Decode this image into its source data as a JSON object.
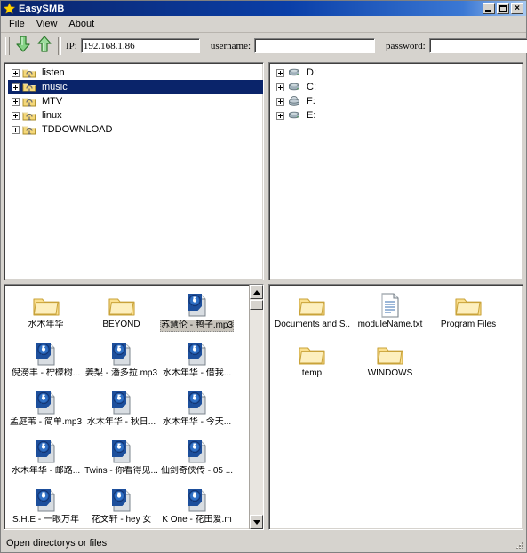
{
  "window": {
    "title": "EasySMB",
    "icon": "star-icon",
    "buttons": {
      "minimize": "minimize-button",
      "maximize": "maximize-button",
      "close": "×"
    }
  },
  "menu": {
    "items": [
      {
        "label": "File",
        "mnemonic": "F"
      },
      {
        "label": "View",
        "mnemonic": "V"
      },
      {
        "label": "About",
        "mnemonic": "A"
      }
    ]
  },
  "toolbar": {
    "download_icon": "green-down-arrow-icon",
    "upload_icon": "green-up-arrow-icon",
    "ip": {
      "label": "IP:",
      "value": "192.168.1.86",
      "placeholder": ""
    },
    "username": {
      "label": "username:",
      "value": "",
      "placeholder": ""
    },
    "password": {
      "label": "password:",
      "value": "",
      "placeholder": ""
    }
  },
  "remote_tree": {
    "nodes": [
      {
        "label": "listen",
        "icon": "share-folder-icon",
        "selected": false
      },
      {
        "label": "music",
        "icon": "share-folder-icon",
        "selected": true
      },
      {
        "label": "MTV",
        "icon": "share-folder-icon",
        "selected": false
      },
      {
        "label": "linux",
        "icon": "share-folder-icon",
        "selected": false
      },
      {
        "label": "TDDOWNLOAD",
        "icon": "share-folder-icon",
        "selected": false
      }
    ]
  },
  "local_tree": {
    "nodes": [
      {
        "label": "D:",
        "icon": "hard-drive-icon",
        "selected": false
      },
      {
        "label": "C:",
        "icon": "hard-drive-icon",
        "selected": false
      },
      {
        "label": "F:",
        "icon": "cdrom-drive-icon",
        "selected": false
      },
      {
        "label": "E:",
        "icon": "hard-drive-icon",
        "selected": false
      }
    ]
  },
  "remote_files": {
    "items": [
      {
        "name": "水木年华",
        "icon": "folder-icon",
        "selected": false
      },
      {
        "name": "BEYOND",
        "icon": "folder-icon",
        "selected": false
      },
      {
        "name": "苏慧伦 - 鸭子.mp3",
        "icon": "media-file-icon",
        "selected": true
      },
      {
        "name": "倪澇丰 - 柠檬树...",
        "icon": "media-file-icon",
        "selected": false
      },
      {
        "name": "姜梨 - 潘多拉.mp3",
        "icon": "media-file-icon",
        "selected": false
      },
      {
        "name": "水木年华 - 借我...",
        "icon": "media-file-icon",
        "selected": false
      },
      {
        "name": "孟庭苇 - 简单.mp3",
        "icon": "media-file-icon",
        "selected": false
      },
      {
        "name": "水木年华 - 秋日...",
        "icon": "media-file-icon",
        "selected": false
      },
      {
        "name": "水木年华 - 今天...",
        "icon": "media-file-icon",
        "selected": false
      },
      {
        "name": "水木年华 - 邮路...",
        "icon": "media-file-icon",
        "selected": false
      },
      {
        "name": "Twins - 你看得见...",
        "icon": "media-file-icon",
        "selected": false
      },
      {
        "name": "仙剑奇侠传 - 05 ...",
        "icon": "media-file-icon",
        "selected": false
      },
      {
        "name": "S.H.E - 一眼万年",
        "icon": "media-file-icon",
        "selected": false
      },
      {
        "name": "花文轩 - hey 女",
        "icon": "media-file-icon",
        "selected": false
      },
      {
        "name": "K One - 花田爱.m",
        "icon": "media-file-icon",
        "selected": false
      }
    ],
    "scrollbar": {
      "visible": true,
      "thumb_position": "top"
    }
  },
  "local_files": {
    "items": [
      {
        "name": "Documents and S...",
        "icon": "folder-icon",
        "selected": false
      },
      {
        "name": "moduleName.txt",
        "icon": "text-file-icon",
        "selected": false
      },
      {
        "name": "Program Files",
        "icon": "folder-icon",
        "selected": false
      },
      {
        "name": "temp",
        "icon": "folder-icon",
        "selected": false
      },
      {
        "name": "WINDOWS",
        "icon": "folder-icon",
        "selected": false
      }
    ]
  },
  "statusbar": {
    "text": "Open directorys or files"
  },
  "colors": {
    "titlebar_start": "#0a246a",
    "titlebar_end": "#a6c8f0",
    "selection": "#0a246a",
    "face": "#d6d3ce",
    "panel_bg": "#ffffff",
    "folder": "#ffd96b",
    "arrow_green": "#6ec96e"
  }
}
